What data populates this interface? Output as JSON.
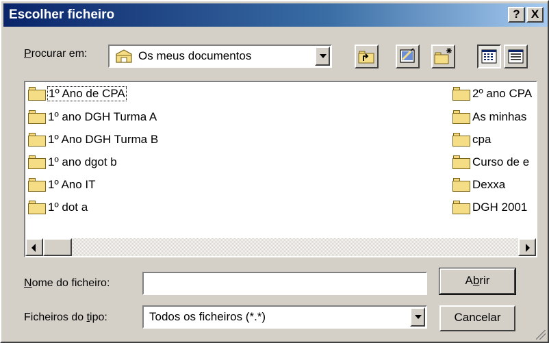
{
  "window": {
    "title": "Escolher ficheiro",
    "help_button": "?",
    "close_button": "X"
  },
  "look_in": {
    "label_prefix": "",
    "label_hotkey": "P",
    "label_rest": "rocurar em:",
    "value": "Os meus documentos"
  },
  "toolbar": {
    "buttons": [
      "up-one-level",
      "desktop",
      "new-folder",
      "list-view",
      "details-view"
    ]
  },
  "files": {
    "left_column": [
      "1º Ano de CPA",
      "1º ano DGH Turma A",
      "1º Ano DGH Turma B",
      "1º ano dgot b",
      "1º Ano IT",
      "1º dot a"
    ],
    "right_column": [
      "2º ano CPA",
      "As minhas",
      "cpa",
      "Curso de e",
      "Dexxa",
      "DGH 2001"
    ]
  },
  "file_name": {
    "label_hotkey": "N",
    "label_rest": "ome do ficheiro:",
    "value": ""
  },
  "file_type": {
    "label_prefix": "Ficheiros do ",
    "label_hotkey": "t",
    "label_rest": "ipo:",
    "value": "Todos os ficheiros (*.*)"
  },
  "buttons": {
    "open_prefix": "A",
    "open_hotkey": "b",
    "open_rest": "rir",
    "cancel": "Cancelar"
  },
  "colors": {
    "titlebar_start": "#0a246a",
    "titlebar_end": "#a6caf0",
    "face": "#d4d0c8",
    "folder": "#f5dd86"
  }
}
